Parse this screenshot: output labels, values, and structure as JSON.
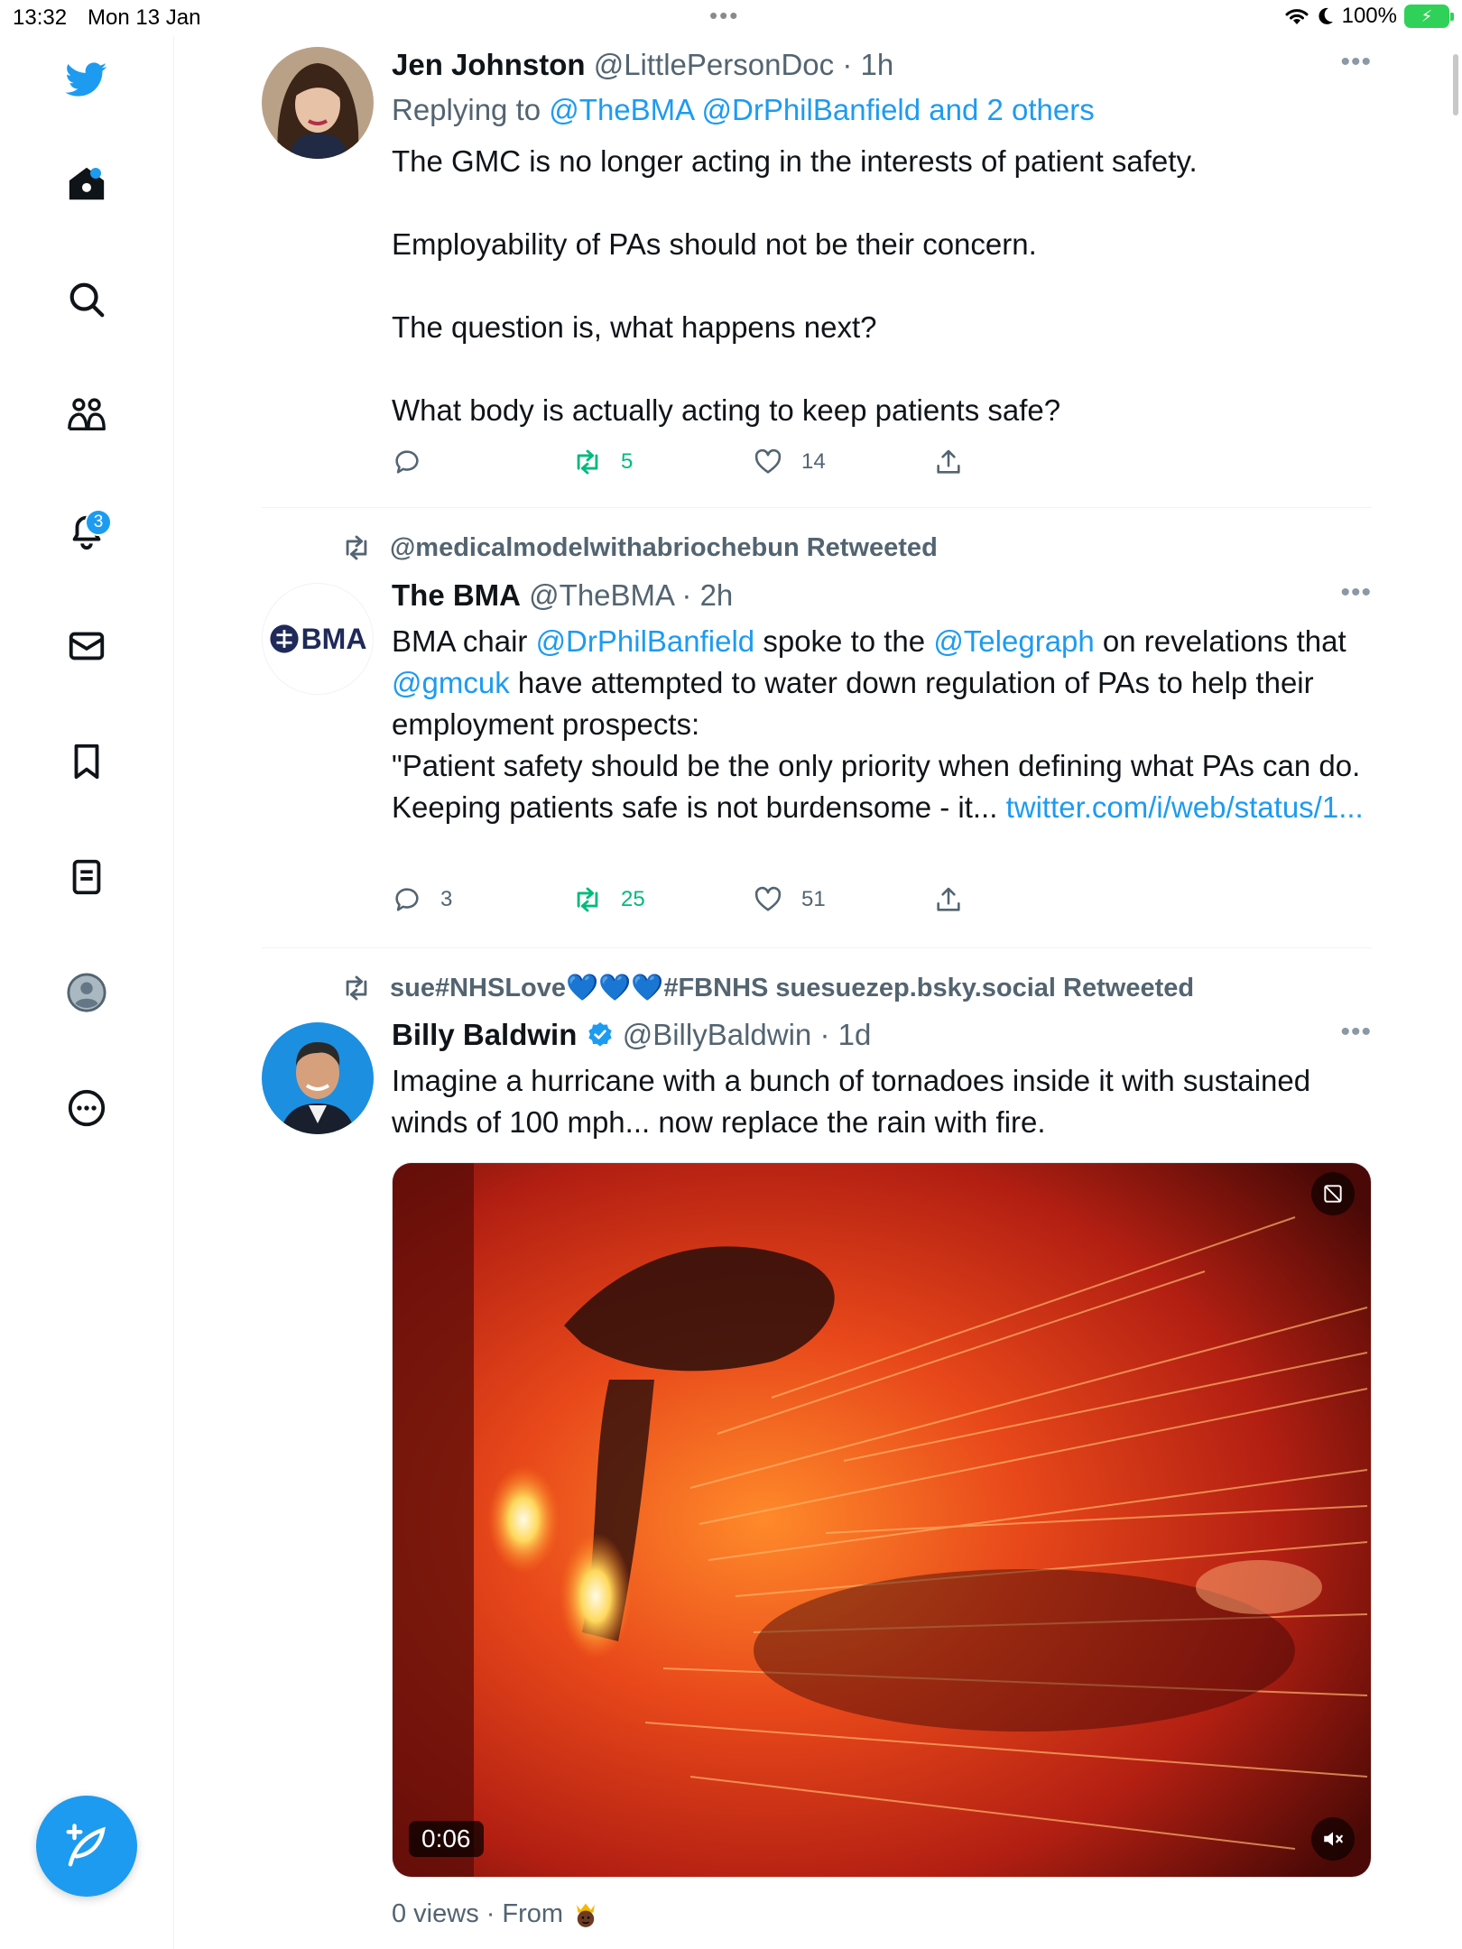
{
  "status_bar": {
    "time": "13:32",
    "date": "Mon 13 Jan",
    "battery": "100%",
    "multitask": "•••"
  },
  "sidebar": {
    "notifications_badge": "3",
    "accent": "#1d9bf0"
  },
  "tweets": [
    {
      "name": "Jen Johnston",
      "handle": "@LittlePersonDoc",
      "time": "· 1h",
      "reply_prefix": "Replying to",
      "reply_targets": "@TheBMA @DrPhilBanfield and 2 others",
      "paragraphs": [
        "The GMC is no longer acting in the interests of patient safety.",
        "Employability of PAs should not be their concern.",
        "The question is, what happens next?",
        "What body is actually acting to keep patients safe?"
      ],
      "replies": "",
      "retweets": "5",
      "likes": "14"
    },
    {
      "retweeted_by": "@medicalmodelwithabriochebun Retweeted",
      "name": "The BMA",
      "handle": "@TheBMA",
      "time": "· 2h",
      "avatar_text": "BMA",
      "text_segments": {
        "s1": "BMA chair ",
        "m1": "@DrPhilBanfield",
        "s2": " spoke to the ",
        "m2": "@Telegraph",
        "s3": " on revelations that ",
        "m3": "@gmcuk",
        "s4": " have attempted to water down regulation of PAs to help their employment prospects:",
        "quote": "\"Patient safety should be the only priority when defining what PAs can do. Keeping patients safe is not burdensome - it... ",
        "link": "twitter.com/i/web/status/1..."
      },
      "replies": "3",
      "retweets": "25",
      "likes": "51"
    },
    {
      "retweeted_by": "sue#NHSLove💙💙💙#FBNHS suesuezep.bsky.social Retweeted",
      "name": "Billy Baldwin",
      "handle": "@BillyBaldwin",
      "time": "· 1d",
      "verified": true,
      "text": "Imagine a hurricane with a bunch of tornadoes inside it with sustained winds of 100 mph... now replace the rain with fire.",
      "video_duration": "0:06",
      "views": "0 views",
      "from": "· From"
    }
  ]
}
